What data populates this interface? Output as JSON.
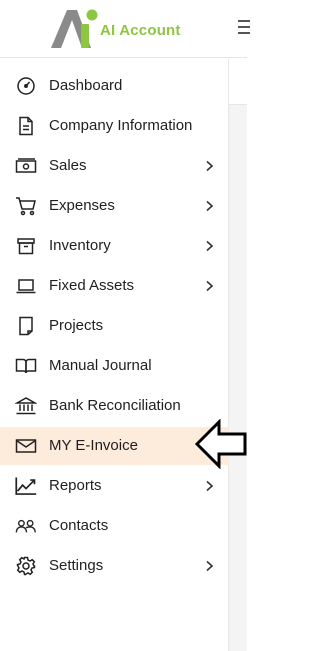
{
  "header": {
    "brand_name": "AI Account",
    "logo_icon": "ai-account-logo",
    "menu_icon": "hamburger-icon"
  },
  "colors": {
    "brand_green": "#8dc63f",
    "logo_grey": "#8a8a8a",
    "active_bg": "#fdebdc",
    "text": "#1f1f1f"
  },
  "sidebar": {
    "items": [
      {
        "label": "Dashboard",
        "icon": "dashboard-gauge-icon",
        "has_submenu": false,
        "active": false
      },
      {
        "label": "Company Information",
        "icon": "document-icon",
        "has_submenu": false,
        "active": false
      },
      {
        "label": "Sales",
        "icon": "cash-icon",
        "has_submenu": true,
        "active": false
      },
      {
        "label": "Expenses",
        "icon": "cart-icon",
        "has_submenu": true,
        "active": false
      },
      {
        "label": "Inventory",
        "icon": "box-icon",
        "has_submenu": true,
        "active": false
      },
      {
        "label": "Fixed Assets",
        "icon": "laptop-icon",
        "has_submenu": true,
        "active": false
      },
      {
        "label": "Projects",
        "icon": "projects-icon",
        "has_submenu": false,
        "active": false
      },
      {
        "label": "Manual Journal",
        "icon": "book-icon",
        "has_submenu": false,
        "active": false
      },
      {
        "label": "Bank Reconciliation",
        "icon": "bank-icon",
        "has_submenu": false,
        "active": false
      },
      {
        "label": "MY E-Invoice",
        "icon": "envelope-icon",
        "has_submenu": false,
        "active": true
      },
      {
        "label": "Reports",
        "icon": "chart-line-icon",
        "has_submenu": true,
        "active": false
      },
      {
        "label": "Contacts",
        "icon": "users-icon",
        "has_submenu": false,
        "active": false
      },
      {
        "label": "Settings",
        "icon": "gear-icon",
        "has_submenu": true,
        "active": false
      }
    ]
  },
  "annotation": {
    "pointer_icon": "left-arrow-pointer-icon"
  }
}
